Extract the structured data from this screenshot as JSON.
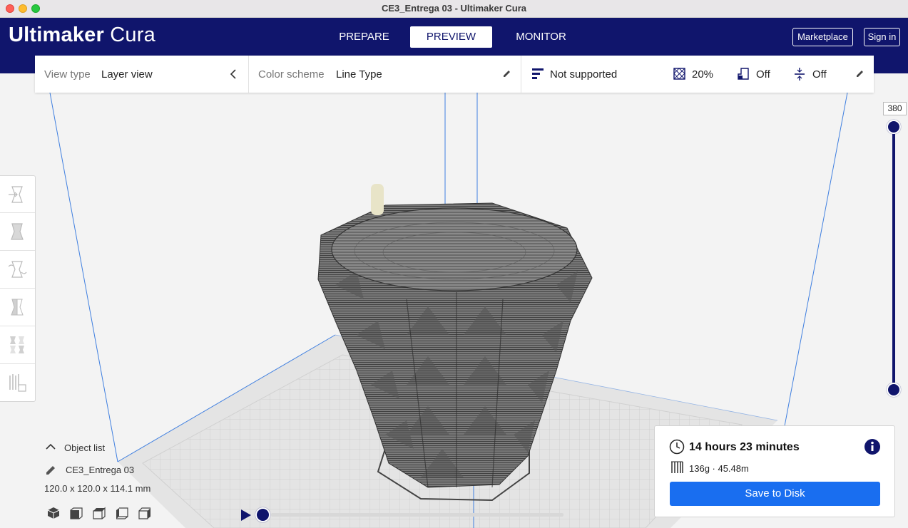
{
  "window": {
    "title": "CE3_Entrega 03 - Ultimaker Cura"
  },
  "header": {
    "logo_bold": "Ultimaker",
    "logo_light": "Cura",
    "tabs": [
      {
        "label": "PREPARE",
        "active": false
      },
      {
        "label": "PREVIEW",
        "active": true
      },
      {
        "label": "MONITOR",
        "active": false
      }
    ],
    "marketplace_label": "Marketplace",
    "signin_label": "Sign in"
  },
  "view_panel": {
    "view_type_label": "View type",
    "view_type_value": "Layer view",
    "color_scheme_label": "Color scheme",
    "color_scheme_value": "Line Type",
    "support_value": "Not supported",
    "infill_value": "20%",
    "support_toggle_value": "Off",
    "adhesion_value": "Off"
  },
  "layer_slider": {
    "max_layer": "380"
  },
  "object_list": {
    "title": "Object list",
    "object_name": "CE3_Entrega 03",
    "dimensions": "120.0 x 120.0 x 114.1 mm"
  },
  "print_info": {
    "time": "14 hours 23 minutes",
    "material": "136g · 45.48m",
    "save_label": "Save to Disk"
  },
  "colors": {
    "brand": "#10156c",
    "accent": "#196ef0",
    "model": "#6a6a6a"
  }
}
